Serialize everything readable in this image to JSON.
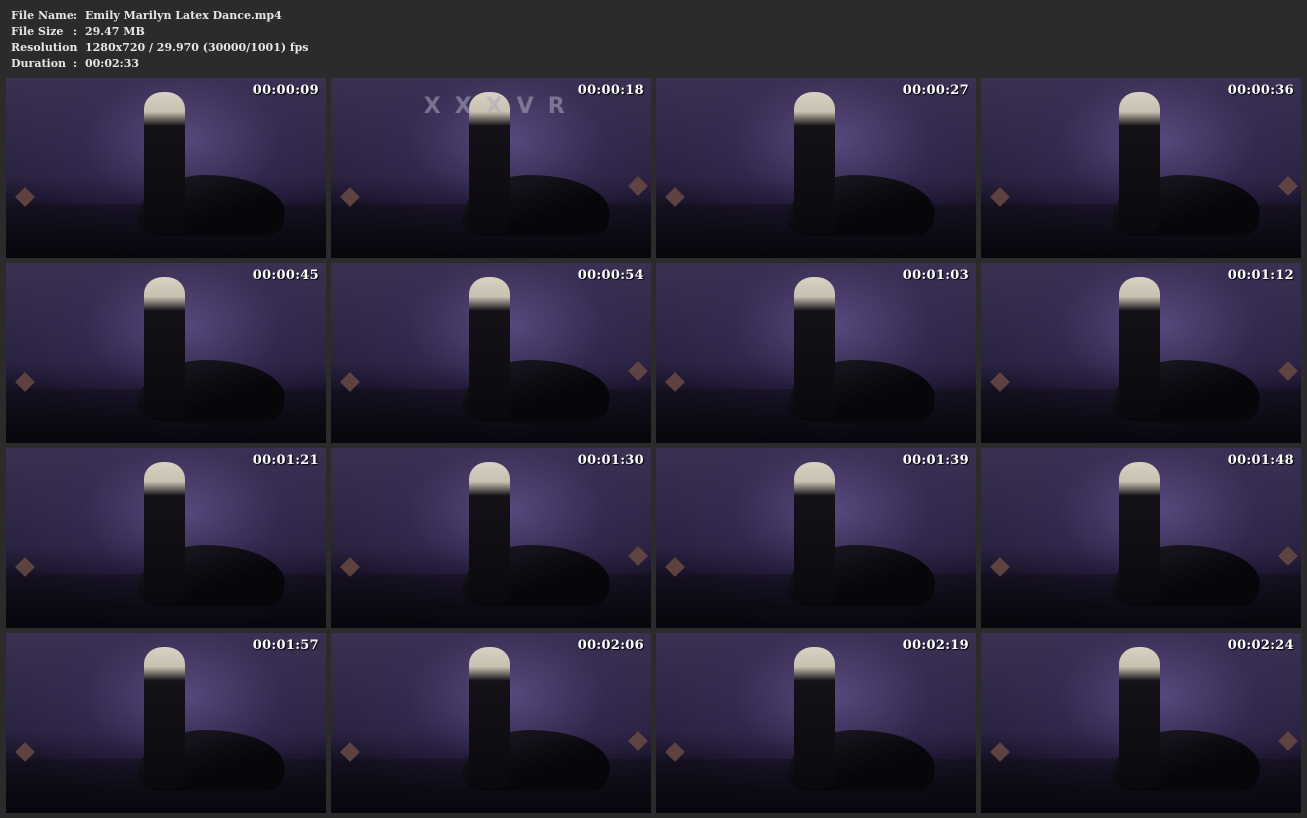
{
  "info": {
    "file_name_label": "File Name",
    "file_name_value": "Emily Marilyn Latex Dance.mp4",
    "file_size_label": "File Size",
    "file_size_value": "29.47 MB",
    "resolution_label": "Resolution",
    "resolution_value": "1280x720 / 29.970 (30000/1001) fps",
    "duration_label": "Duration",
    "duration_value": "00:02:33",
    "separator": ":"
  },
  "thumbnails": [
    {
      "timestamp": "00:00:09"
    },
    {
      "timestamp": "00:00:18",
      "watermark": "XXXVR"
    },
    {
      "timestamp": "00:00:27"
    },
    {
      "timestamp": "00:00:36"
    },
    {
      "timestamp": "00:00:45"
    },
    {
      "timestamp": "00:00:54"
    },
    {
      "timestamp": "00:01:03"
    },
    {
      "timestamp": "00:01:12"
    },
    {
      "timestamp": "00:01:21"
    },
    {
      "timestamp": "00:01:30"
    },
    {
      "timestamp": "00:01:39"
    },
    {
      "timestamp": "00:01:48"
    },
    {
      "timestamp": "00:01:57"
    },
    {
      "timestamp": "00:02:06"
    },
    {
      "timestamp": "00:02:19"
    },
    {
      "timestamp": "00:02:24"
    }
  ],
  "colors": {
    "background": "#2b2b2b",
    "text": "#e6e6e6",
    "timestamp": "#ffffff"
  }
}
